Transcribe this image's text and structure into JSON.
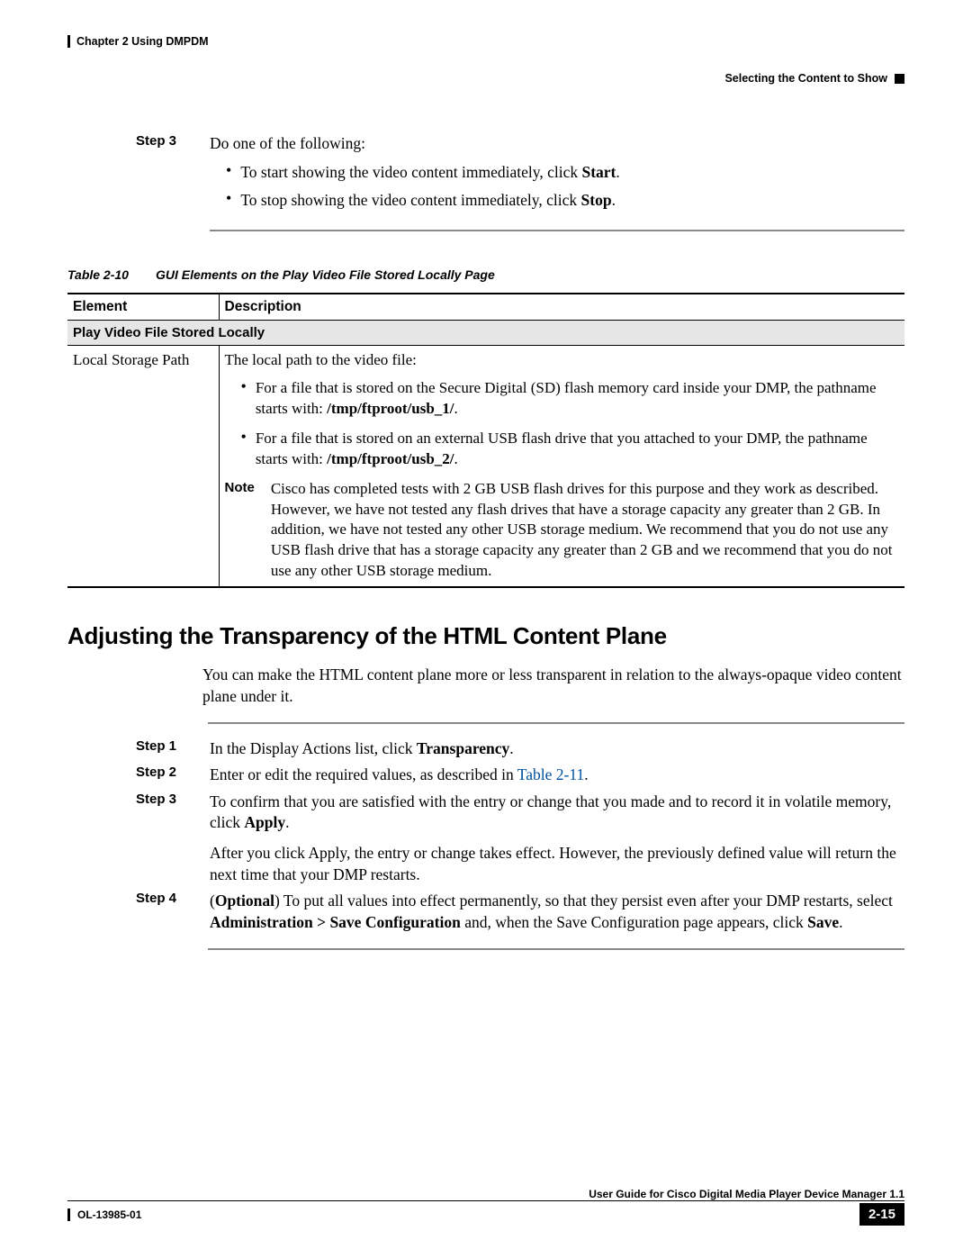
{
  "header": {
    "chapter": "Chapter 2      Using DMPDM",
    "section": "Selecting the Content to Show"
  },
  "stepsA": {
    "step3": {
      "label": "Step 3",
      "intro": "Do one of the following:",
      "bullets": [
        {
          "pre": "To start showing the video content immediately, click ",
          "bold": "Start",
          "post": "."
        },
        {
          "pre": "To stop showing the video content immediately, click ",
          "bold": "Stop",
          "post": "."
        }
      ]
    }
  },
  "table": {
    "captionNum": "Table 2-10",
    "captionTitle": "GUI Elements on the Play Video File Stored Locally Page",
    "headers": [
      "Element",
      "Description"
    ],
    "sectionRow": "Play Video File Stored Locally",
    "row": {
      "element": "Local Storage Path",
      "descIntro": "The local path to the video file:",
      "bullets": [
        {
          "pre": "For a file that is stored on the Secure Digital (SD) flash memory card inside your DMP, the pathname starts with: ",
          "bold": "/tmp/ftproot/usb_1/",
          "post": "."
        },
        {
          "pre": "For a file that is stored on an external USB flash drive that you attached to your DMP, the pathname starts with: ",
          "bold": "/tmp/ftproot/usb_2/",
          "post": "."
        }
      ],
      "noteLabel": "Note",
      "noteText": "Cisco has completed tests with 2 GB USB flash drives for this purpose and they work as described. However, we have not tested any flash drives that have a storage capacity any greater than 2 GB. In addition, we have not tested any other USB storage medium. We recommend that you do not use any USB flash drive that has a storage capacity any greater than 2 GB and we recommend that you do not use any other USB storage medium."
    }
  },
  "heading2": "Adjusting the Transparency of the HTML Content Plane",
  "paraIntro": "You can make the HTML content plane more or less transparent in relation to the always-opaque video content plane under it.",
  "stepsB": {
    "step1": {
      "label": "Step 1",
      "pre": "In the Display Actions list, click ",
      "bold": "Transparency",
      "post": "."
    },
    "step2": {
      "label": "Step 2",
      "pre": "Enter or edit the required values, as described in ",
      "link": "Table 2-11",
      "post": "."
    },
    "step3": {
      "label": "Step 3",
      "pre": "To confirm that you are satisfied with the entry or change that you made and to record it in volatile memory, click ",
      "bold": "Apply",
      "post": ".",
      "after": "After you click Apply, the entry or change takes effect. However, the previously defined value will return the next time that your DMP restarts."
    },
    "step4": {
      "label": "Step 4",
      "optBold": "Optional",
      "preParen": "(",
      "postParen": ") ",
      "text1": "To put all values into effect permanently, so that they persist even after your DMP restarts, select ",
      "bold2": "Administration > Save Configuration",
      "text2": " and, when the Save Configuration page appears, click ",
      "bold3": "Save",
      "post": "."
    }
  },
  "footer": {
    "guide": "User Guide for Cisco Digital Media Player Device Manager 1.1",
    "docnum": "OL-13985-01",
    "page": "2-15"
  }
}
